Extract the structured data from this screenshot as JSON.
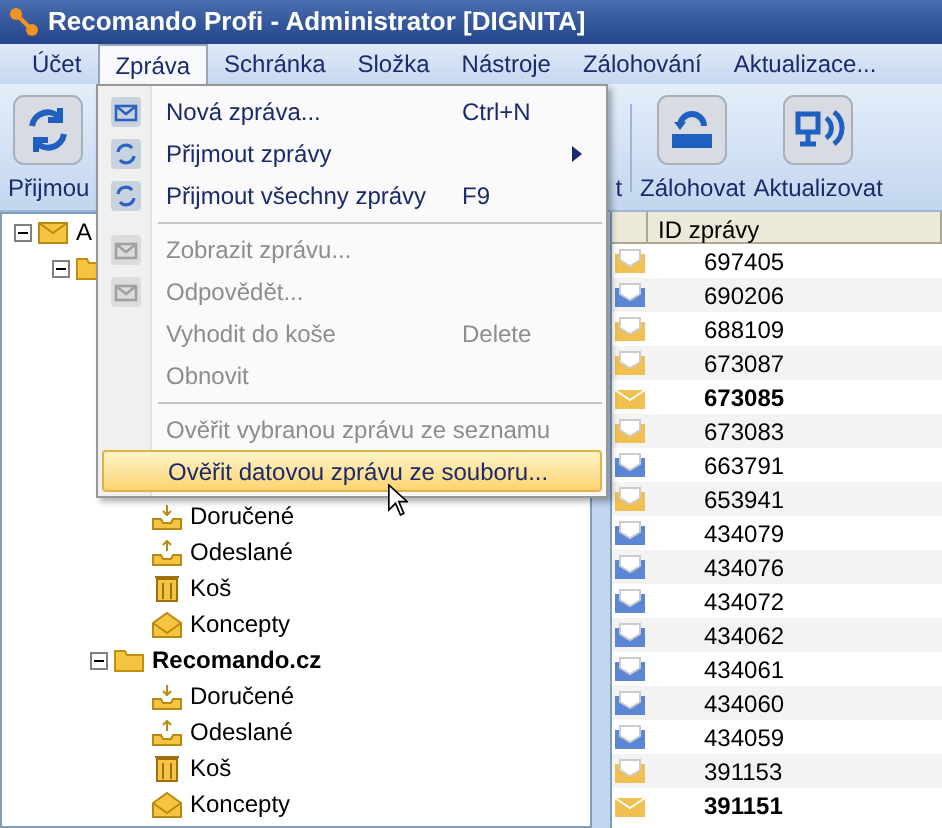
{
  "window": {
    "title": "Recomando Profi - Administrator [DIGNITA]"
  },
  "menubar": [
    {
      "label": "Účet",
      "selected": false
    },
    {
      "label": "Zpráva",
      "selected": true
    },
    {
      "label": "Schránka",
      "selected": false
    },
    {
      "label": "Složka",
      "selected": false
    },
    {
      "label": "Nástroje",
      "selected": false
    },
    {
      "label": "Zálohování",
      "selected": false
    },
    {
      "label": "Aktualizace...",
      "selected": false
    }
  ],
  "toolbar": [
    {
      "label": "Přijmou",
      "kind": "receive"
    },
    {
      "label": "t",
      "kind": "text"
    },
    {
      "label": "Zálohovat",
      "kind": "backup",
      "separator_before": true
    },
    {
      "label": "Aktualizovat",
      "kind": "update"
    }
  ],
  "tree": [
    {
      "label": "A",
      "kind": "account",
      "expanded": true,
      "children": [
        {
          "kind": "folder",
          "expanded": true,
          "children": [
            {
              "kind": "hidden",
              "children": [
                {
                  "label": "Doručené",
                  "kind": "inbox"
                },
                {
                  "label": "Odeslané",
                  "kind": "outbox"
                },
                {
                  "label": "Koš",
                  "kind": "trash"
                },
                {
                  "label": "Koncepty",
                  "kind": "drafts"
                }
              ]
            },
            {
              "label": "Recomando.cz",
              "kind": "folder",
              "expanded": true,
              "children": [
                {
                  "label": "Doručené",
                  "kind": "inbox"
                },
                {
                  "label": "Odeslané",
                  "kind": "outbox"
                },
                {
                  "label": "Koš",
                  "kind": "trash"
                },
                {
                  "label": "Koncepty",
                  "kind": "drafts"
                }
              ]
            }
          ]
        }
      ]
    }
  ],
  "message_list": {
    "columns": [
      "ID zprávy"
    ],
    "rows": [
      {
        "id": "697405",
        "color": "#f0c050",
        "unread": false
      },
      {
        "id": "690206",
        "color": "#5b86d6",
        "unread": false
      },
      {
        "id": "688109",
        "color": "#f0c050",
        "unread": false
      },
      {
        "id": "673087",
        "color": "#f0c050",
        "unread": false
      },
      {
        "id": "673085",
        "color": "#f0c050",
        "unread": true
      },
      {
        "id": "673083",
        "color": "#f0c050",
        "unread": false
      },
      {
        "id": "663791",
        "color": "#5b86d6",
        "unread": false
      },
      {
        "id": "653941",
        "color": "#f0c050",
        "unread": false
      },
      {
        "id": "434079",
        "color": "#5b86d6",
        "unread": false
      },
      {
        "id": "434076",
        "color": "#5b86d6",
        "unread": false
      },
      {
        "id": "434072",
        "color": "#5b86d6",
        "unread": false
      },
      {
        "id": "434062",
        "color": "#5b86d6",
        "unread": false
      },
      {
        "id": "434061",
        "color": "#5b86d6",
        "unread": false
      },
      {
        "id": "434060",
        "color": "#5b86d6",
        "unread": false
      },
      {
        "id": "434059",
        "color": "#5b86d6",
        "unread": false
      },
      {
        "id": "391153",
        "color": "#f0c050",
        "unread": false
      },
      {
        "id": "391151",
        "color": "#f0c050",
        "unread": true
      }
    ]
  },
  "dropdown_menu": [
    {
      "kind": "new",
      "label": "Nová zpráva...",
      "shortcut": "Ctrl+N",
      "disabled": false,
      "selected": false
    },
    {
      "kind": "receive",
      "label": "Přijmout zprávy",
      "submenu": true,
      "disabled": false,
      "selected": false
    },
    {
      "kind": "receive",
      "label": "Přijmout všechny zprávy",
      "shortcut": "F9",
      "disabled": false,
      "selected": false
    },
    {
      "kind": "separator"
    },
    {
      "kind": "view",
      "label": "Zobrazit zprávu...",
      "disabled": true,
      "selected": false
    },
    {
      "kind": "reply",
      "label": "Odpovědět...",
      "disabled": true,
      "selected": false
    },
    {
      "kind": "item",
      "label": "Vyhodit do koše",
      "shortcut": "Delete",
      "disabled": true,
      "selected": false
    },
    {
      "kind": "item",
      "label": "Obnovit",
      "disabled": true,
      "selected": false
    },
    {
      "kind": "separator"
    },
    {
      "kind": "item",
      "label": "Ověřit vybranou zprávu ze seznamu",
      "disabled": true,
      "selected": false
    },
    {
      "kind": "item",
      "label": "Ověřit datovou zprávu ze souboru...",
      "disabled": false,
      "selected": true
    }
  ]
}
